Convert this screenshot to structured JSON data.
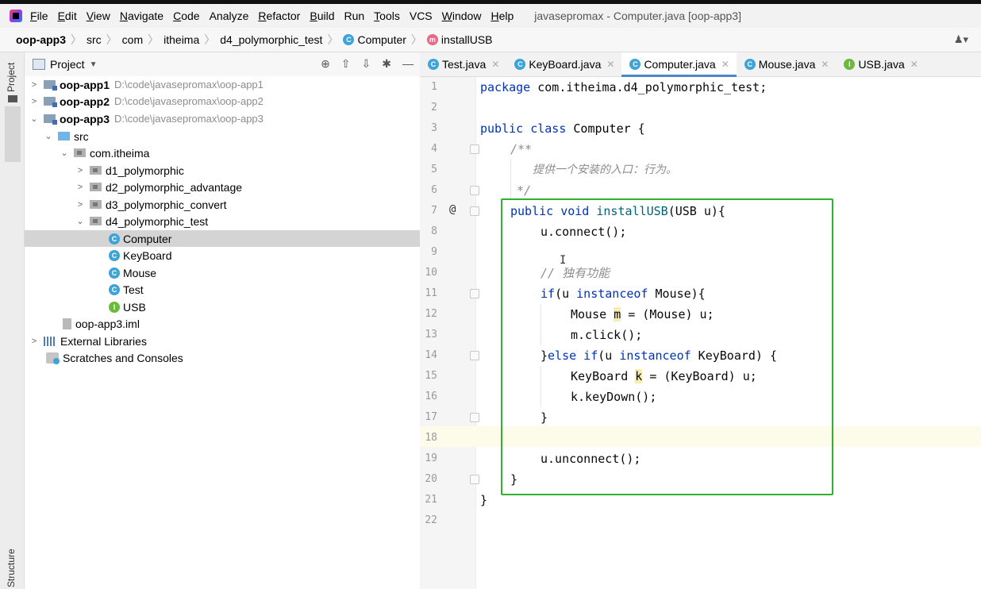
{
  "window": {
    "title": "javasepromax - Computer.java [oop-app3]",
    "menu": [
      {
        "label": "File",
        "mnemonic": "F",
        "rest": "ile"
      },
      {
        "label": "Edit",
        "mnemonic": "E",
        "rest": "dit"
      },
      {
        "label": "View",
        "mnemonic": "V",
        "rest": "iew"
      },
      {
        "label": "Navigate",
        "mnemonic": "N",
        "rest": "avigate"
      },
      {
        "label": "Code",
        "mnemonic": "C",
        "rest": "ode"
      },
      {
        "label": "Analyze",
        "mnemonic": "",
        "rest": "Analyze"
      },
      {
        "label": "Refactor",
        "mnemonic": "R",
        "rest": "efactor"
      },
      {
        "label": "Build",
        "mnemonic": "B",
        "rest": "uild"
      },
      {
        "label": "Run",
        "mnemonic": "",
        "rest": "Run"
      },
      {
        "label": "Tools",
        "mnemonic": "T",
        "rest": "ools"
      },
      {
        "label": "VCS",
        "mnemonic": "",
        "rest": "VCS"
      },
      {
        "label": "Window",
        "mnemonic": "W",
        "rest": "indow"
      },
      {
        "label": "Help",
        "mnemonic": "H",
        "rest": "elp"
      }
    ]
  },
  "breadcrumb": {
    "items": [
      "oop-app3",
      "src",
      "com",
      "itheima",
      "d4_polymorphic_test",
      "Computer",
      "installUSB"
    ]
  },
  "side_tabs": {
    "project": "Project",
    "structure": "Structure"
  },
  "project_panel": {
    "header": "Project",
    "tree": [
      {
        "label": "oop-app1",
        "path": "D:\\code\\javasepromax\\oop-app1",
        "icon": "module-icon"
      },
      {
        "label": "oop-app2",
        "path": "D:\\code\\javasepromax\\oop-app2",
        "icon": "module-icon"
      },
      {
        "label": "oop-app3",
        "path": "D:\\code\\javasepromax\\oop-app3",
        "icon": "module-icon"
      },
      {
        "label": "src",
        "icon": "source-folder-icon"
      },
      {
        "label": "com.itheima",
        "icon": "package-icon"
      },
      {
        "label": "d1_polymorphic",
        "icon": "package-icon"
      },
      {
        "label": "d2_polymorphic_advantage",
        "icon": "package-icon"
      },
      {
        "label": "d3_polymorphic_convert",
        "icon": "package-icon"
      },
      {
        "label": "d4_polymorphic_test",
        "icon": "package-icon"
      },
      {
        "label": "Computer",
        "icon": "class-icon"
      },
      {
        "label": "KeyBoard",
        "icon": "class-icon"
      },
      {
        "label": "Mouse",
        "icon": "class-icon"
      },
      {
        "label": "Test",
        "icon": "class-icon"
      },
      {
        "label": "USB",
        "icon": "interface-icon"
      },
      {
        "label": "oop-app3.iml",
        "icon": "iml-file-icon"
      },
      {
        "label": "External Libraries",
        "icon": "library-icon"
      },
      {
        "label": "Scratches and Consoles",
        "icon": "scratches-icon"
      }
    ]
  },
  "tabs": [
    {
      "label": "Test.java",
      "kind": "C"
    },
    {
      "label": "KeyBoard.java",
      "kind": "C"
    },
    {
      "label": "Computer.java",
      "kind": "C",
      "active": true
    },
    {
      "label": "Mouse.java",
      "kind": "C"
    },
    {
      "label": "USB.java",
      "kind": "I"
    }
  ],
  "editor": {
    "line_numbers": [
      "1",
      "2",
      "3",
      "4",
      "5",
      "6",
      "7",
      "8",
      "9",
      "10",
      "11",
      "12",
      "13",
      "14",
      "15",
      "16",
      "17",
      "18",
      "19",
      "20",
      "21",
      "22"
    ],
    "current_line": "18",
    "code": {
      "l1_kw": "package",
      "l1_rest": " com.itheima.d4_polymorphic_test;",
      "l3_kw": "public class",
      "l3_name": " Computer",
      "l3_rest": " {",
      "l4": "/**",
      "l5": "提供一个安装的入口：行为。",
      "l6": "*/",
      "l7_kw": "public void",
      "l7_name": " installUSB",
      "l7_rest": "(USB u){",
      "l8": "u.connect();",
      "l10": "// 独有功能",
      "l11_kw": "if",
      "l11_a": "(u ",
      "l11_kw2": "instanceof",
      "l11_b": " Mouse){",
      "l12_a": "Mouse ",
      "l12_var": "m",
      "l12_b": " = (Mouse) u;",
      "l13": "m.click();",
      "l14_a": "}",
      "l14_kw": "else if",
      "l14_b": "(u ",
      "l14_kw2": "instanceof",
      "l14_c": " KeyBoard) {",
      "l15_a": "KeyBoard ",
      "l15_var": "k",
      "l15_b": " = (KeyBoard) u;",
      "l16": "k.keyDown();",
      "l17": "}",
      "l19": "u.unconnect();",
      "l20": "}",
      "l21": "}"
    }
  }
}
